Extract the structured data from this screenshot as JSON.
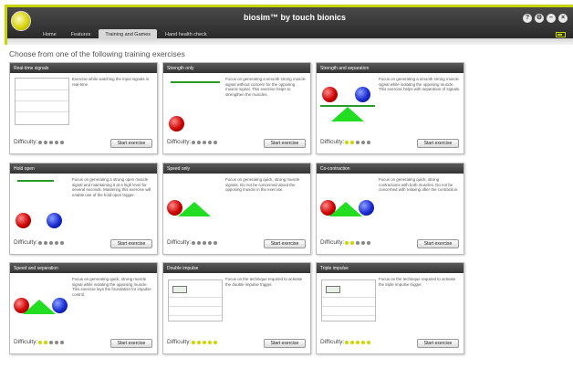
{
  "header": {
    "title": "biosim™ by touch bionics",
    "tabs": [
      "Home",
      "Features",
      "Training and Games",
      "Hand health check"
    ],
    "active_tab": "Training and Games",
    "icons": [
      "help-icon",
      "settings-icon",
      "minimize-icon",
      "close-icon",
      "battery-icon"
    ],
    "accent_color": "#c8d400"
  },
  "heading": "Choose from one of the following training exercises",
  "difficulty_label": "Difficulty:",
  "start_label": "Start exercise",
  "cards": [
    {
      "title": "Real-time signals",
      "desc": "Exercise while watching the input signals in real-time.",
      "difficulty": 0
    },
    {
      "title": "Strength only",
      "desc": "Focus on generating a smooth strong muscle signal without concern for the opposing muscle signal. This exercise helps to strengthen the muscles.",
      "difficulty": 0
    },
    {
      "title": "Strength and separation",
      "desc": "Focus on generating a smooth strong muscle signal while isolating the opposing muscle. This exercise helps with separation of signals.",
      "difficulty": 2
    },
    {
      "title": "Hold open",
      "desc": "Focus on generating a strong open muscle signal and maintaining it at a high level for several seconds. Mastering this exercise will enable use of the hold open trigger.",
      "difficulty": 0
    },
    {
      "title": "Speed only",
      "desc": "Focus on generating quick, strong muscle signals. Do not be concerned about the opposing muscle in the exercise.",
      "difficulty": 0
    },
    {
      "title": "Co-contraction",
      "desc": "Focus on generating quick, strong contractions with both muscles. Do not be concerned with relaxing after the contraction.",
      "difficulty": 2
    },
    {
      "title": "Speed and separation",
      "desc": "Focus on generating quick, strong muscle signal while isolating the opposing muscle. This exercise lays the foundation for impulse control.",
      "difficulty": 2
    },
    {
      "title": "Double impulse",
      "desc": "Focus on the technique required to activate the double impulse trigger.",
      "difficulty": 5
    },
    {
      "title": "Triple impulse",
      "desc": "Focus on the technique required to activate the triple impulse trigger.",
      "difficulty": 5
    }
  ]
}
